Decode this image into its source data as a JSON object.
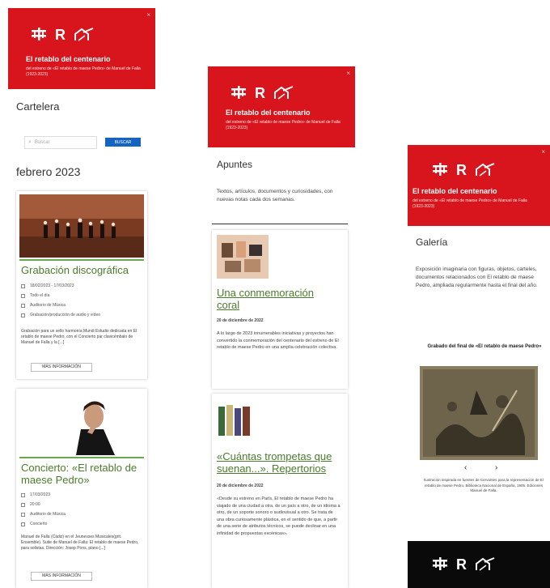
{
  "banner": {
    "title": "El retablo del centenario",
    "subtitle": "del estreno de «El retablo de maese Pedro» de Manuel de Falla (1923-2023)",
    "close_label": "×",
    "logo_letter": "R"
  },
  "cartelera": {
    "heading": "Cartelera",
    "search_placeholder": "Buscar",
    "search_button": "BUSCAR",
    "month": "febrero 2023",
    "cards": [
      {
        "title": "Grabación discográfica",
        "meta": [
          "18/02/2023 - 17/03/2023",
          "Todo el día",
          "Auditorio de Música",
          "Grabación/producción de audio y vídeo"
        ],
        "description": "Grabación para un sello harmonía Mundi Estudio dedicada en El retablo de maese Pedro, con el Concierto par clavicémbalo de Manuel de Falla y la [...]",
        "button": "MÁS INFORMACIÓN"
      },
      {
        "title": "Concierto: «El retablo de maese Pedro»",
        "meta": [
          "17/03/2023",
          "20:00",
          "Auditorio de Música",
          "Concierto"
        ],
        "description": "Manuel de Falla (Cádiz) en el Jeunesses Musicales(grit. Ensemble). Suite de Manuel de Falla: El retablo de maese Pedro, para solistas. Dirección: Josep Pons, piano [...]",
        "button": "MÁS INFORMACIÓN"
      }
    ]
  },
  "apuntes": {
    "heading": "Apuntes",
    "intro": "Textos, artículos, documentos y curiosidades, con nuevas notas cada dos semanas.",
    "articles": [
      {
        "title": "Una conmemoración coral",
        "date": "20 de diciembre de 2022",
        "body": "A lo largo de 2023 innumerables iniciativas y proyectos han convertido la conmemoración del centenario del estreno de El retablo de maese Pedro en una amplia celebración colectiva."
      },
      {
        "title": "«Cuántas trompetas que suenan...». Repertorios",
        "date": "20 de diciembre de 2022",
        "body": "«Desde su estreno en París, El retablo de maese Pedro ha viajado de una ciudad a otra, de un país a otro, de un idioma a otro, de un soporte sonoro o audiovisual a otro. Se trata de una obra curiosamente plástica, en el sentido de que, a partir de una serie de atributos técnicos, se puede declinar en una infinidad de propuestas escénicas»."
      }
    ]
  },
  "galeria": {
    "heading": "Galería",
    "intro": "Exposición imaginaria con figuras, objetos, carteles, documentos relacionados con El retablo de maese Pedro, ampliada regularmente hasta el final del año.",
    "figure_title": "Grabado del final de «El retablo de maese Pedro»",
    "caption": "Ilustración inspirada en fuentes de Cervantes para la representación de El retablo de maese Pedro, Biblioteca Nacional de España, 1905. Ediciones Manuel de Falla.",
    "prev": "‹",
    "next": "›"
  },
  "colors": {
    "brand_red": "#d8141c",
    "accent_green": "#4a7c2c",
    "link_blue": "#1565c0"
  }
}
